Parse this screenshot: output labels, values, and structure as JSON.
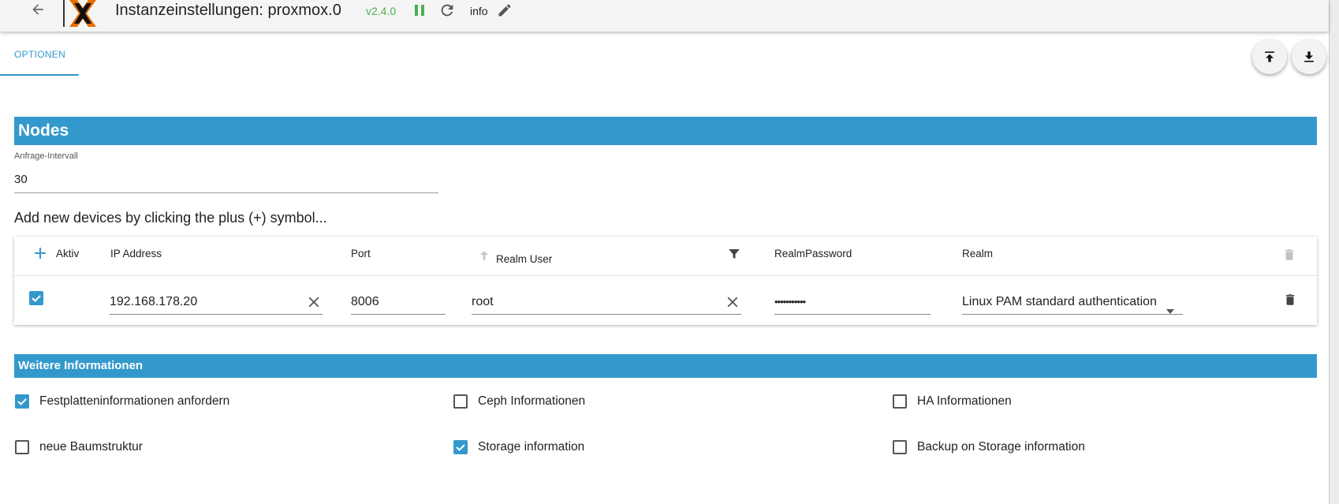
{
  "header": {
    "title": "Instanzeinstellungen:  proxmox.0",
    "version": "v2.4.0",
    "info_label": "info"
  },
  "tabs": [
    {
      "label": "OPTIONEN"
    }
  ],
  "nodes": {
    "heading": "Nodes",
    "interval_label": "Anfrage-Intervall",
    "interval_value": "30",
    "hint": "Add new devices by clicking the plus (+) symbol..."
  },
  "table": {
    "columns": {
      "active": "Aktiv",
      "ip": "IP Address",
      "port": "Port",
      "user": "Realm User",
      "password": "RealmPassword",
      "realm": "Realm"
    },
    "rows": [
      {
        "active": true,
        "ip": "192.168.178.20",
        "port": "8006",
        "user": "root",
        "password": "•••••••••••",
        "realm": "Linux PAM standard authentication"
      }
    ]
  },
  "more": {
    "heading": "Weitere Informationen",
    "options": [
      {
        "label": "Festplatteninformationen anfordern",
        "checked": true
      },
      {
        "label": "Ceph Informationen",
        "checked": false
      },
      {
        "label": "HA Informationen",
        "checked": false
      },
      {
        "label": "neue Baumstruktur",
        "checked": false
      },
      {
        "label": "Storage information",
        "checked": true
      },
      {
        "label": "Backup on Storage information",
        "checked": false
      }
    ]
  },
  "colors": {
    "accent": "#3399cc",
    "version_green": "#4caf50"
  }
}
